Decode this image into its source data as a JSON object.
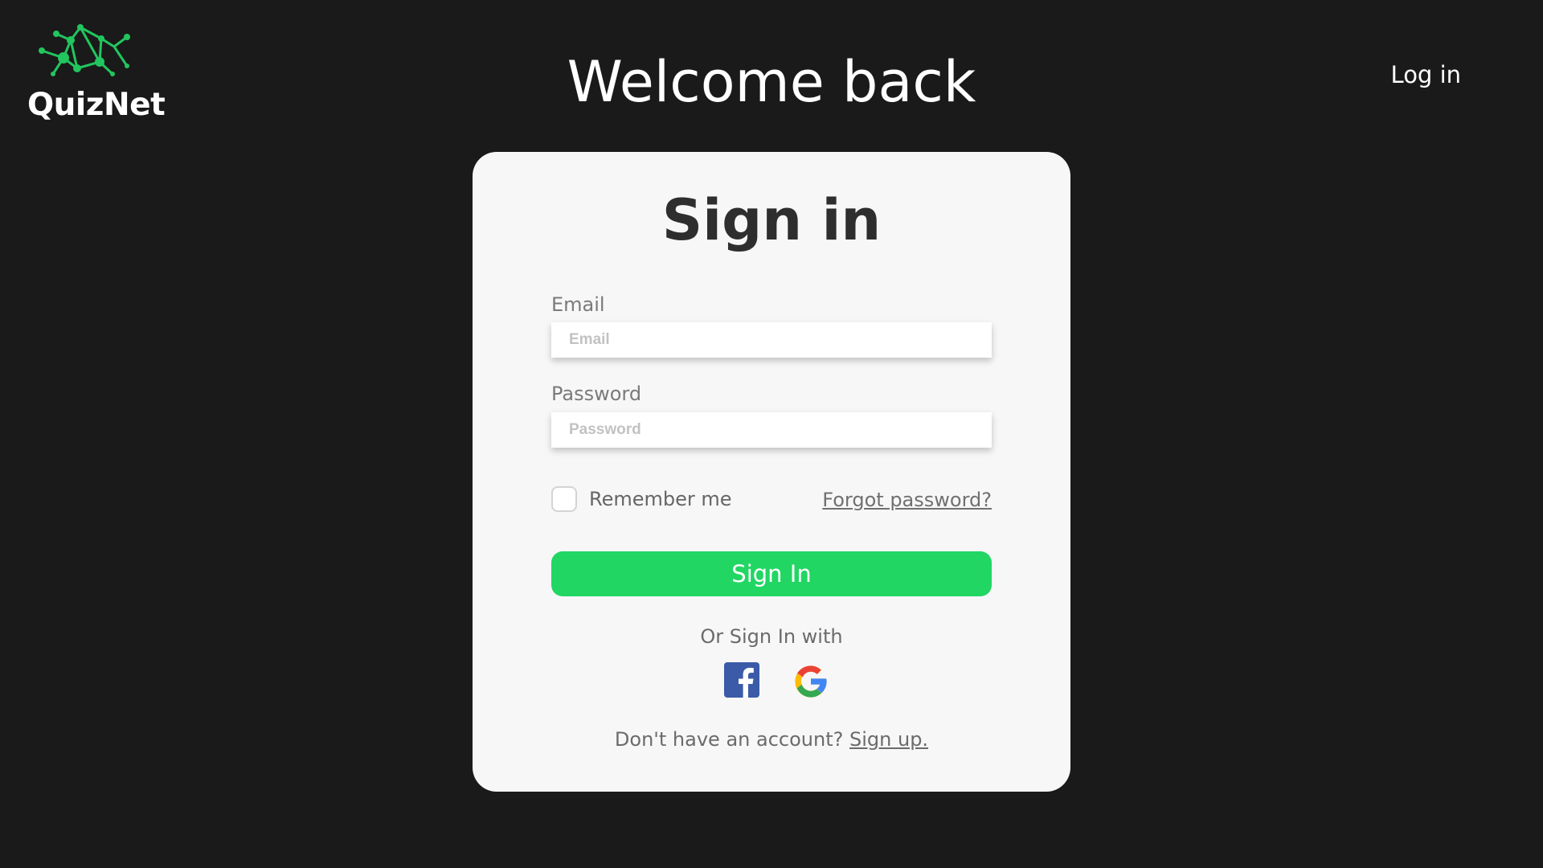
{
  "header": {
    "logo_text": "QuizNet",
    "welcome_title": "Welcome back",
    "login_link": "Log in"
  },
  "signin": {
    "title": "Sign in",
    "email_label": "Email",
    "email_placeholder": "Email",
    "email_value": "",
    "password_label": "Password",
    "password_placeholder": "Password",
    "password_value": "",
    "remember_label": "Remember me",
    "remember_checked": false,
    "forgot_link": "Forgot password?",
    "submit_label": "Sign In",
    "alt_text": "Or Sign In with",
    "social": [
      {
        "name": "facebook-icon",
        "glyph": "f"
      },
      {
        "name": "google-icon",
        "glyph": "G"
      }
    ],
    "signup_prompt": "Don't have an account?",
    "signup_link": "Sign up."
  },
  "colors": {
    "page_background": "#1a1a1a",
    "card_background": "#f7f7f7",
    "accent_green": "#21d663",
    "facebook_blue": "#3b5ba8",
    "google_blue": "#4285f4",
    "google_red": "#ea4335",
    "google_yellow": "#fbbc05",
    "google_green": "#34a853",
    "logo_green": "#22c55e"
  }
}
